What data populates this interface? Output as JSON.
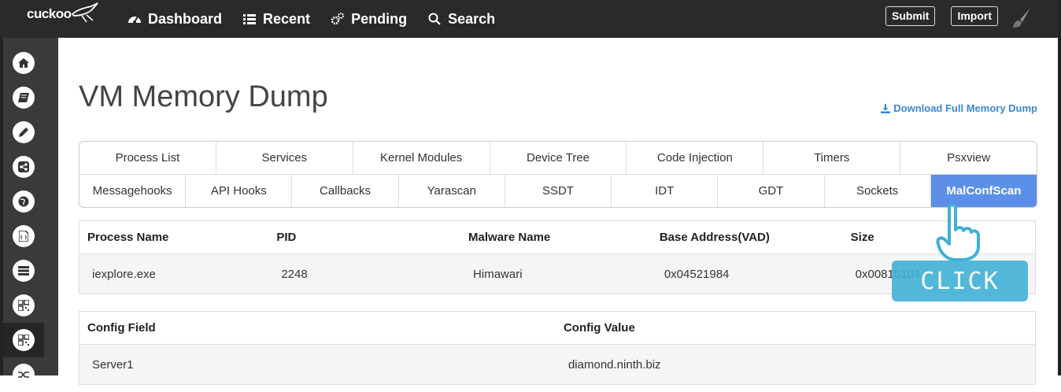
{
  "navbar": {
    "brand": "cuckoo",
    "items": [
      {
        "label": "Dashboard",
        "icon": "dashboard-icon"
      },
      {
        "label": "Recent",
        "icon": "list-icon"
      },
      {
        "label": "Pending",
        "icon": "cogs-icon"
      },
      {
        "label": "Search",
        "icon": "search-icon"
      }
    ],
    "submit_label": "Submit",
    "import_label": "Import"
  },
  "sidebar": {
    "items": [
      {
        "icon": "home-icon"
      },
      {
        "icon": "book-icon"
      },
      {
        "icon": "pencil-icon"
      },
      {
        "icon": "share-icon"
      },
      {
        "icon": "globe-icon"
      },
      {
        "icon": "code-file-icon"
      },
      {
        "icon": "server-icon"
      },
      {
        "icon": "qrcode-icon"
      },
      {
        "icon": "qrcode-icon",
        "active": true
      },
      {
        "icon": "random-icon"
      }
    ]
  },
  "page": {
    "title": "VM Memory Dump",
    "download_label": "Download Full Memory Dump"
  },
  "tabs": {
    "row1": [
      "Process List",
      "Services",
      "Kernel Modules",
      "Device Tree",
      "Code Injection",
      "Timers",
      "Psxview"
    ],
    "row2": [
      "Messagehooks",
      "API Hooks",
      "Callbacks",
      "Yarascan",
      "SSDT",
      "IDT",
      "GDT",
      "Sockets",
      "MalConfScan"
    ],
    "active": "MalConfScan"
  },
  "process_table": {
    "headers": [
      "Process Name",
      "PID",
      "Malware Name",
      "Base Address(VAD)",
      "Size"
    ],
    "rows": [
      [
        "iexplore.exe",
        "2248",
        "Himawari",
        "0x04521984",
        "0x00815104"
      ]
    ]
  },
  "config_table": {
    "headers": [
      "Config Field",
      "Config Value"
    ],
    "rows": [
      [
        "Server1",
        "diamond.ninth.biz"
      ]
    ]
  },
  "overlay": {
    "click_label": "CLICK"
  },
  "colors": {
    "navbar": "#2a2a2a",
    "sidebar": "#3a3a3a",
    "active_tab": "#5b8fe8",
    "link": "#3a87d6",
    "click_badge": "#40b0d6"
  }
}
